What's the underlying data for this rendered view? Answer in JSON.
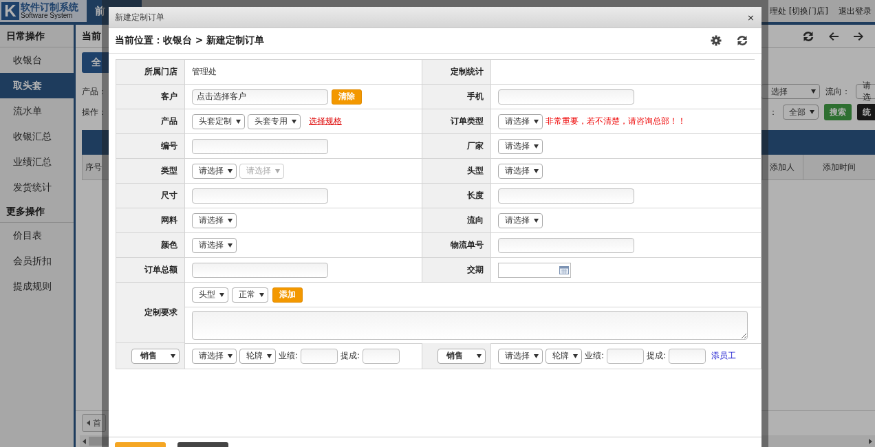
{
  "app": {
    "logo_letter": "K",
    "logo_title": "软件订制系统",
    "logo_subtitle": "Software System",
    "nav_tab": "前",
    "store": "理处 [切换门店]",
    "logout": "退出登录"
  },
  "sidebar": {
    "sections": [
      {
        "title": "日常操作",
        "items": [
          {
            "label": "收银台",
            "selected": false
          },
          {
            "label": "取头套",
            "selected": true
          },
          {
            "label": "流水单",
            "selected": false
          },
          {
            "label": "收银汇总",
            "selected": false
          },
          {
            "label": "业绩汇总",
            "selected": false
          },
          {
            "label": "发货统计",
            "selected": false
          }
        ]
      },
      {
        "title": "更多操作",
        "items": [
          {
            "label": "价目表",
            "selected": false
          },
          {
            "label": "会员折扣",
            "selected": false
          },
          {
            "label": "提成规则",
            "selected": false
          }
        ]
      }
    ]
  },
  "background_page": {
    "breadcrumb": "当前",
    "all_button": "全",
    "product_label": "产品：",
    "operation_label": "操作：",
    "filter_select": "选择",
    "flow_label": "流向：",
    "flow_select": "请选",
    "colon": "：",
    "scope_select": "全部",
    "search_button": "搜索",
    "stats_button": "统",
    "columns": [
      "序号",
      "添加人",
      "添加时间"
    ],
    "pager_button": "首"
  },
  "dialog": {
    "title": "新建定制订单",
    "close": "×",
    "breadcrumb": "当前位置：收银台 > 新建定制订单",
    "form_rows": [
      {
        "cells": [
          {
            "label": "所属门店",
            "controls": [
              {
                "kind": "text",
                "text": "管理处"
              }
            ]
          },
          {
            "label": "定制统计"
          }
        ]
      },
      {
        "cells": [
          {
            "label": "客户",
            "controls": [
              {
                "kind": "input",
                "value": "点击选择客户"
              },
              {
                "kind": "button",
                "label": "清除"
              }
            ]
          },
          {
            "label": "手机",
            "controls": [
              {
                "kind": "input"
              }
            ]
          }
        ]
      },
      {
        "cells": [
          {
            "label": "产品",
            "controls": [
              {
                "kind": "select",
                "value": "头套定制",
                "disabled": false
              },
              {
                "kind": "select",
                "value": "头套专用",
                "disabled": false
              },
              {
                "kind": "alert-link",
                "text": "选择规格"
              }
            ]
          },
          {
            "label": "订单类型",
            "controls": [
              {
                "kind": "select",
                "value": "请选择",
                "disabled": false
              },
              {
                "kind": "note",
                "text": "非常重要，若不清楚，请咨询总部！！"
              }
            ]
          }
        ]
      },
      {
        "cells": [
          {
            "label": "编号",
            "controls": [
              {
                "kind": "input"
              }
            ]
          },
          {
            "label": "厂家",
            "controls": [
              {
                "kind": "select",
                "value": "请选择",
                "disabled": false
              }
            ]
          }
        ]
      },
      {
        "cells": [
          {
            "label": "类型",
            "controls": [
              {
                "kind": "select",
                "value": "请选择",
                "disabled": false
              },
              {
                "kind": "select",
                "value": "请选择",
                "disabled": true
              }
            ]
          },
          {
            "label": "头型",
            "controls": [
              {
                "kind": "select",
                "value": "请选择",
                "disabled": false
              }
            ]
          }
        ]
      },
      {
        "cells": [
          {
            "label": "尺寸",
            "controls": [
              {
                "kind": "input"
              }
            ]
          },
          {
            "label": "长度",
            "controls": [
              {
                "kind": "input"
              }
            ]
          }
        ]
      },
      {
        "cells": [
          {
            "label": "网料",
            "controls": [
              {
                "kind": "select",
                "value": "请选择",
                "disabled": false
              }
            ]
          },
          {
            "label": "流向",
            "controls": [
              {
                "kind": "select",
                "value": "请选择",
                "disabled": false
              }
            ]
          }
        ]
      },
      {
        "cells": [
          {
            "label": "颜色",
            "controls": [
              {
                "kind": "select",
                "value": "请选择",
                "disabled": false
              }
            ]
          },
          {
            "label": "物流单号",
            "controls": [
              {
                "kind": "input"
              }
            ]
          }
        ]
      },
      {
        "cells": [
          {
            "label": "订单总额",
            "controls": [
              {
                "kind": "input"
              }
            ]
          },
          {
            "label": "交期",
            "controls": [
              {
                "kind": "date"
              }
            ]
          }
        ]
      }
    ],
    "custom": {
      "label": "定制要求",
      "rows": [
        {
          "controls": [
            {
              "kind": "select",
              "value": "头型",
              "disabled": false
            },
            {
              "kind": "select",
              "value": "正常",
              "disabled": false
            },
            {
              "kind": "button",
              "label": "添加"
            }
          ]
        },
        {
          "controls": [
            {
              "kind": "textarea"
            }
          ]
        }
      ]
    },
    "staff": [
      {
        "role": "销售",
        "controls": [
          {
            "kind": "select",
            "value": "请选择",
            "disabled": false
          },
          {
            "kind": "select",
            "value": "轮牌",
            "disabled": false
          },
          {
            "kind": "label",
            "text": "业绩:"
          },
          {
            "kind": "small-input"
          },
          {
            "kind": "label",
            "text": "提成:"
          },
          {
            "kind": "small-input"
          }
        ]
      },
      {
        "role": "销售",
        "controls": [
          {
            "kind": "select",
            "value": "请选择",
            "disabled": false
          },
          {
            "kind": "select",
            "value": "轮牌",
            "disabled": false
          },
          {
            "kind": "label",
            "text": "业绩:"
          },
          {
            "kind": "small-input"
          },
          {
            "kind": "label",
            "text": "提成:"
          },
          {
            "kind": "small-input"
          },
          {
            "kind": "link",
            "text": "添员工"
          }
        ]
      }
    ],
    "footer_buttons": [
      {
        "kind": "primary"
      },
      {
        "kind": "dark"
      }
    ]
  }
}
